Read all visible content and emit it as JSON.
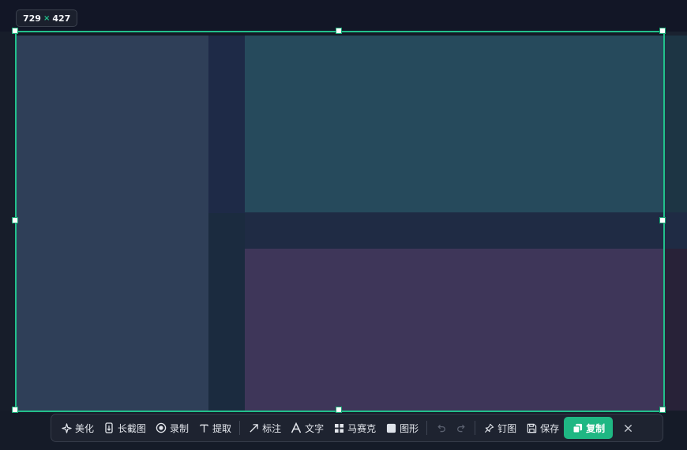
{
  "size_badge": {
    "width": "729",
    "times": "×",
    "height": "427"
  },
  "colors": {
    "accent": "#22c08b",
    "copy_button": "#1fb783",
    "toolbar_bg": "#1e2330"
  },
  "toolbar": {
    "beautify": {
      "label": "美化",
      "icon": "sparkle-icon"
    },
    "long_screenshot": {
      "label": "长截图",
      "icon": "long-screenshot-icon"
    },
    "record": {
      "label": "录制",
      "icon": "record-icon"
    },
    "extract": {
      "label": "提取",
      "icon": "text-extract-icon"
    },
    "annotate": {
      "label": "标注",
      "icon": "arrow-icon"
    },
    "text": {
      "label": "文字",
      "icon": "text-icon"
    },
    "mosaic": {
      "label": "马赛克",
      "icon": "mosaic-icon"
    },
    "shape": {
      "label": "图形",
      "icon": "shape-icon"
    },
    "undo": {
      "icon": "undo-icon"
    },
    "redo": {
      "icon": "redo-icon"
    },
    "pin": {
      "label": "钉图",
      "icon": "pin-icon"
    },
    "save": {
      "label": "保存",
      "icon": "save-icon"
    },
    "copy": {
      "label": "复制",
      "icon": "copy-icon"
    },
    "close": {
      "icon": "close-icon"
    }
  }
}
